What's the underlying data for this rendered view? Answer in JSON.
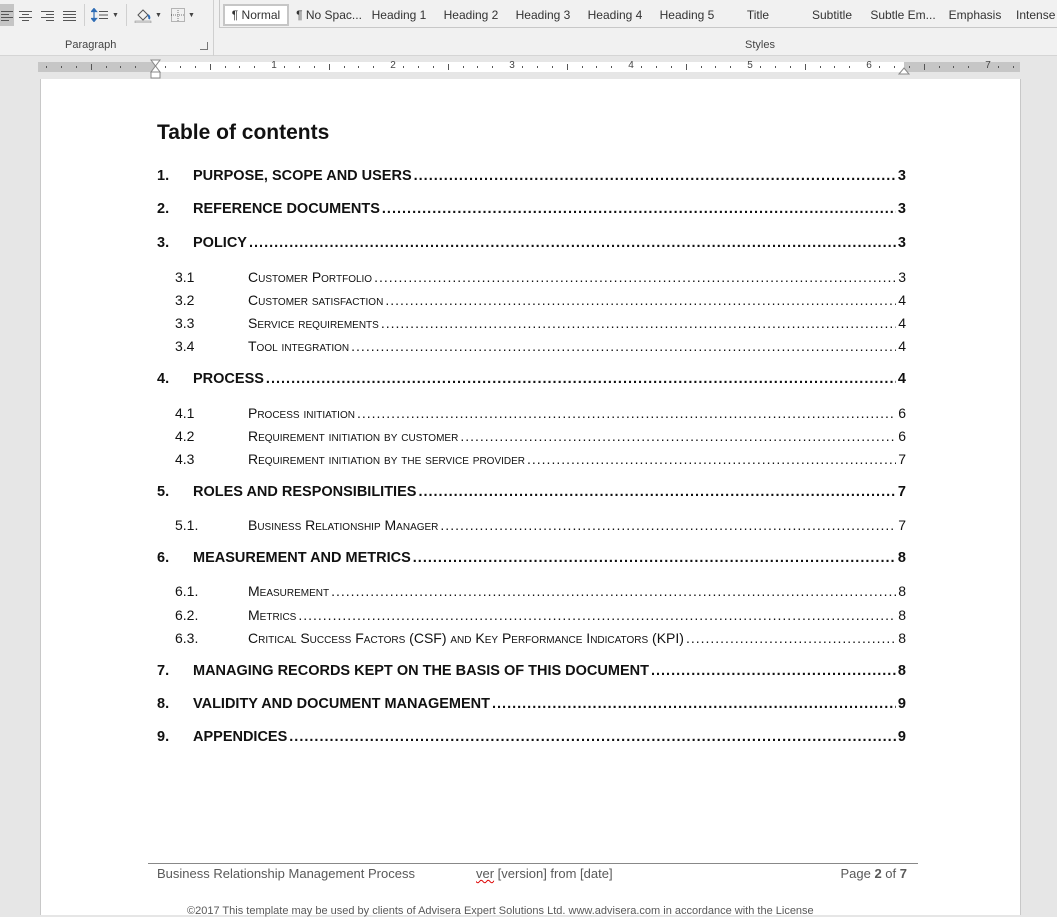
{
  "ribbon": {
    "paragraph_group": {
      "label": "Paragraph",
      "buttons": [
        {
          "name": "align-left",
          "active": true
        },
        {
          "name": "align-center",
          "active": false
        },
        {
          "name": "align-right",
          "active": false
        },
        {
          "name": "justify",
          "active": false
        },
        {
          "name": "line-spacing",
          "active": false
        },
        {
          "name": "shading",
          "active": false
        },
        {
          "name": "borders",
          "active": false
        }
      ]
    },
    "styles_group": {
      "label": "Styles",
      "items": [
        "¶ Normal",
        "¶ No Spac...",
        "Heading 1",
        "Heading 2",
        "Heading 3",
        "Heading 4",
        "Heading 5",
        "Title",
        "Subtitle",
        "Subtle Em...",
        "Emphasis",
        "Intense"
      ],
      "selected": "¶ Normal"
    }
  },
  "ruler": {
    "numbers": [
      "1",
      "2",
      "3",
      "4",
      "5",
      "6",
      "7"
    ]
  },
  "document": {
    "toc_title": "Table of contents",
    "entries": [
      {
        "level": 1,
        "num": "1.",
        "text": "PURPOSE, SCOPE AND USERS",
        "page": "3"
      },
      {
        "level": 1,
        "num": "2.",
        "text": "REFERENCE DOCUMENTS",
        "page": "3"
      },
      {
        "level": 1,
        "num": "3.",
        "text": "POLICY",
        "page": "3"
      },
      {
        "level": 2,
        "num": "3.1",
        "text": "Customer Portfolio",
        "page": "3"
      },
      {
        "level": 2,
        "num": "3.2",
        "text": "Customer satisfaction",
        "page": "4"
      },
      {
        "level": 2,
        "num": "3.3",
        "text": "Service requirements",
        "page": "4"
      },
      {
        "level": 2,
        "num": "3.4",
        "text": "Tool integration",
        "page": "4"
      },
      {
        "level": 1,
        "num": "4.",
        "text": "PROCESS",
        "page": "4"
      },
      {
        "level": 2,
        "num": "4.1",
        "text": "Process initiation",
        "page": "6"
      },
      {
        "level": 2,
        "num": "4.2",
        "text": "Requirement initiation by customer",
        "page": "6"
      },
      {
        "level": 2,
        "num": "4.3",
        "text": "Requirement initiation by the service provider",
        "page": "7"
      },
      {
        "level": 1,
        "num": "5.",
        "text": "ROLES AND RESPONSIBILITIES",
        "page": "7"
      },
      {
        "level": 2,
        "num": "5.1.",
        "text": "Business Relationship Manager",
        "page": "7"
      },
      {
        "level": 1,
        "num": "6.",
        "text": "MEASUREMENT AND METRICS",
        "page": "8"
      },
      {
        "level": 2,
        "num": "6.1.",
        "text": "Measurement",
        "page": "8"
      },
      {
        "level": 2,
        "num": "6.2.",
        "text": "Metrics",
        "page": "8"
      },
      {
        "level": 2,
        "num": "6.3.",
        "text": "Critical Success Factors (CSF) and Key Performance Indicators (KPI)",
        "page": "8"
      },
      {
        "level": 1,
        "num": "7.",
        "text": "MANAGING RECORDS KEPT ON THE BASIS OF THIS DOCUMENT",
        "page": "8"
      },
      {
        "level": 1,
        "num": "8.",
        "text": "VALIDITY AND DOCUMENT MANAGEMENT",
        "page": "9"
      },
      {
        "level": 1,
        "num": "9.",
        "text": "APPENDICES",
        "page": "9"
      }
    ],
    "footer": {
      "left": "Business Relationship Management Process",
      "center_word": "ver",
      "center_rest": " [version] from [date]",
      "page_prefix": "Page ",
      "page_current": "2",
      "page_of": " of ",
      "page_total": "7",
      "copyright": "©2017 This template may be used by clients of Advisera Expert Solutions Ltd. www.advisera.com in accordance with the License"
    }
  }
}
